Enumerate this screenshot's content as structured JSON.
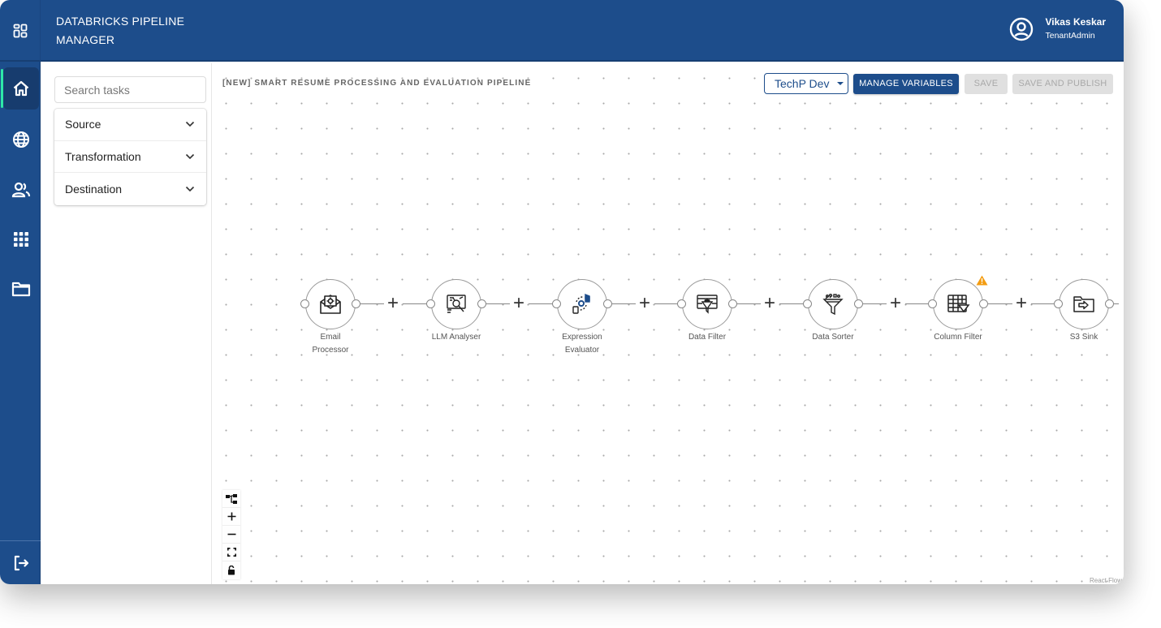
{
  "header": {
    "title": "DATABRICKS PIPELINE MANAGER",
    "user_name": "Vikas Keskar",
    "user_role": "TenantAdmin"
  },
  "sidebar": {
    "items": [
      {
        "name": "home",
        "icon": "home-icon",
        "active": true
      },
      {
        "name": "globe",
        "icon": "globe-icon",
        "active": false
      },
      {
        "name": "users",
        "icon": "users-icon",
        "active": false
      },
      {
        "name": "apps",
        "icon": "grid-icon",
        "active": false
      },
      {
        "name": "folder",
        "icon": "folder-icon",
        "active": false
      }
    ],
    "logout_icon": "logout-icon",
    "accent_color": "#2ee6a8"
  },
  "tasks": {
    "search_placeholder": "Search tasks",
    "search_value": "",
    "categories": [
      {
        "label": "Source"
      },
      {
        "label": "Transformation"
      },
      {
        "label": "Destination"
      }
    ]
  },
  "canvas": {
    "pipeline_title": "[NEW] SMART RESUME PROCESSING AND EVALUATION PIPELINE",
    "environment": "TechP Dev",
    "manage_variables_label": "MANAGE VARIABLES",
    "save_label": "SAVE",
    "save_publish_label": "SAVE AND PUBLISH",
    "nodes": [
      {
        "label": "Email Processor",
        "icon": "email-gear-icon",
        "warning": false
      },
      {
        "label": "LLM Analyser",
        "icon": "llm-analysis-icon",
        "warning": false
      },
      {
        "label": "Expression Evaluator",
        "icon": "expression-icon",
        "warning": false
      },
      {
        "label": "Data Filter",
        "icon": "data-filter-icon",
        "warning": false
      },
      {
        "label": "Data Sorter",
        "icon": "data-sorter-icon",
        "warning": false
      },
      {
        "label": "Column Filter",
        "icon": "column-filter-icon",
        "warning": true
      },
      {
        "label": "S3 Sink",
        "icon": "folder-arrow-icon",
        "warning": false
      }
    ],
    "controls": [
      "layout",
      "zoom-in",
      "zoom-out",
      "fit-view",
      "lock"
    ],
    "attribution": "React Flow"
  },
  "colors": {
    "brand": "#1d4d8b",
    "warning": "#f39c12",
    "disabled_bg": "#e0e0e0"
  }
}
